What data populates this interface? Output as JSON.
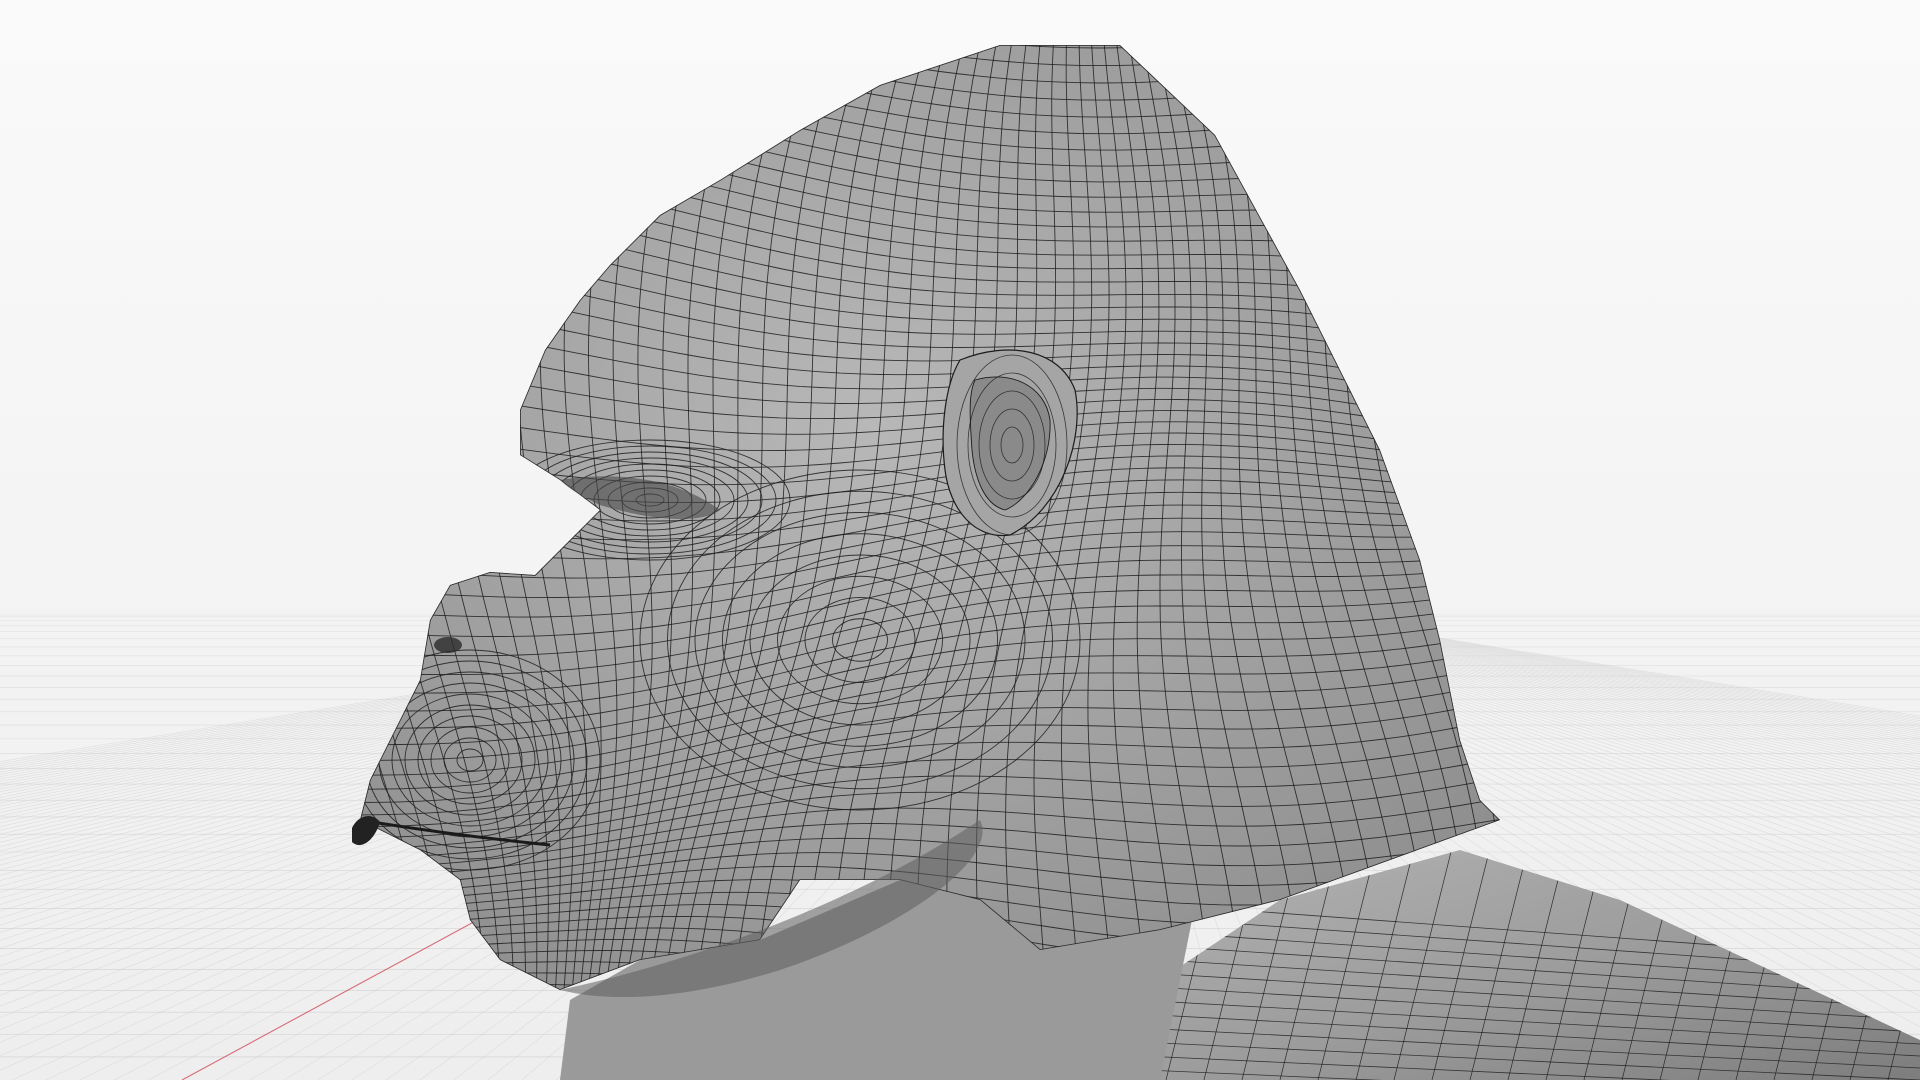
{
  "viewport": {
    "object_icon": "wireframe-mesh-icon",
    "colors": {
      "background": "#f3f3f3",
      "grid_line": "#c9c9c9",
      "axis_line": "#d14b5c",
      "mesh_fill": "#9c9c9c",
      "mesh_shadow": "#6f6f6f",
      "wire": "#1c1c1c"
    }
  }
}
